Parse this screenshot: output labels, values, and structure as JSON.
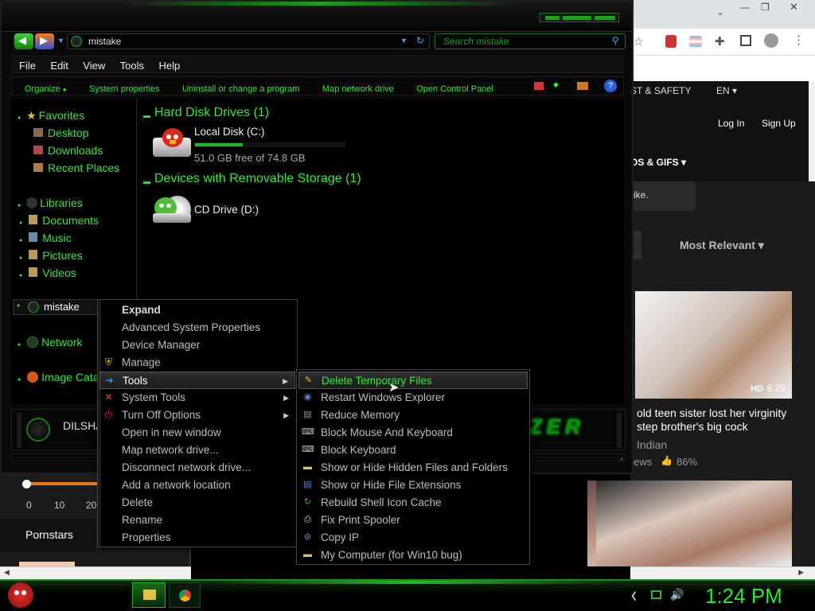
{
  "browser": {
    "nav_links": [
      "ST & SAFETY",
      "EN ▾"
    ],
    "login": "Log In",
    "signup": "Sign Up",
    "category": "OS & GIFS ▾",
    "like_snippet": "ike.",
    "sort": "Most Relevant ▾",
    "video": {
      "quality": "HD",
      "duration": "8:29",
      "title": "old teen sister lost her virginity step brother's big cock",
      "channel": "Indian",
      "views_label": "ews",
      "rating": "86%"
    },
    "slider_ticks": [
      "0",
      "10",
      "20"
    ],
    "pornstars_label": "Pornstars"
  },
  "explorer": {
    "address": "mistake",
    "search_placeholder": "Search mistake",
    "menubar": [
      "File",
      "Edit",
      "View",
      "Tools",
      "Help"
    ],
    "commands": [
      "Organize",
      "System properties",
      "Uninstall or change a program",
      "Map network drive",
      "Open Control Panel"
    ],
    "nav": {
      "favorites": "Favorites",
      "favorite_items": [
        "Desktop",
        "Downloads",
        "Recent Places"
      ],
      "libraries": "Libraries",
      "library_items": [
        "Documents",
        "Music",
        "Pictures",
        "Videos"
      ],
      "computer": "mistake",
      "network": "Network",
      "image_catalog": "Image Catal"
    },
    "sections": {
      "hdd_title": "Hard Disk Drives (1)",
      "removable_title": "Devices with Removable Storage (1)"
    },
    "drives": {
      "local_name": "Local Disk (C:)",
      "local_free": "51.0 GB free of 74.8 GB",
      "local_used_fraction": 0.318,
      "cd_name": "CD Drive (D:)"
    },
    "details_user": "DILSHA",
    "details_brand": "ZER"
  },
  "context_menu": {
    "items": [
      {
        "label": "Expand",
        "bold": true
      },
      {
        "label": "Advanced System Properties"
      },
      {
        "label": "Device Manager"
      },
      {
        "label": "Manage",
        "icon": "shield-icon"
      },
      {
        "label": "Tools",
        "icon": "arrow-right-icon",
        "submenu": true,
        "highlight": true
      },
      {
        "label": "System Tools",
        "icon": "wrench-icon",
        "submenu": true
      },
      {
        "label": "Turn Off Options",
        "icon": "power-icon",
        "submenu": true
      },
      {
        "label": "Open in new window"
      },
      {
        "label": "Map network drive..."
      },
      {
        "label": "Disconnect network drive..."
      },
      {
        "label": "Add a network location"
      },
      {
        "label": "Delete"
      },
      {
        "label": "Rename"
      },
      {
        "label": "Properties"
      }
    ]
  },
  "submenu": {
    "items": [
      {
        "label": "Delete Temporary Files",
        "icon": "broom-icon",
        "highlight": true
      },
      {
        "label": "Restart Windows Explorer",
        "icon": "globe-icon"
      },
      {
        "label": "Reduce Memory",
        "icon": "memory-icon"
      },
      {
        "label": "Block Mouse And Keyboard",
        "icon": "keyboard-icon"
      },
      {
        "label": "Block Keyboard",
        "icon": "keyboard-icon"
      },
      {
        "label": "Show or Hide Hidden Files and Folders",
        "icon": "folder-icon"
      },
      {
        "label": "Show or Hide File Extensions",
        "icon": "file-icon"
      },
      {
        "label": "Rebuild Shell Icon Cache",
        "icon": "refresh-icon"
      },
      {
        "label": "Fix Print Spooler",
        "icon": "printer-icon"
      },
      {
        "label": "Copy IP",
        "icon": "ip-icon"
      },
      {
        "label": "My Computer (for Win10 bug)",
        "icon": "folder-icon"
      }
    ]
  },
  "taskbar": {
    "clock": "1:24 PM"
  },
  "colors": {
    "accent": "#39e839",
    "menu_bg": "#000000",
    "highlight_bg": "#2a2a2a"
  }
}
